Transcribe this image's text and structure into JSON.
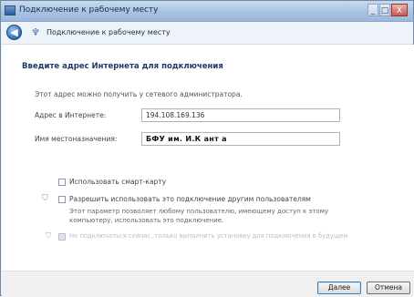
{
  "window": {
    "title": "Подключение к рабочему месту",
    "min_glyph": "_",
    "max_glyph": "□",
    "close_glyph": "X"
  },
  "nav": {
    "back_glyph": "◀",
    "title": "Подключение к рабочему месту"
  },
  "content": {
    "heading": "Введите адрес Интернета для подключения",
    "info": "Этот адрес можно получить у сетевого администратора.",
    "address_label": "Адрес в Интернете:",
    "address_value": "194.108.169.136",
    "name_label": "Имя местоназначения:",
    "name_value": "БФУ им. И.К ант а",
    "option_smartcard": "Использовать смарт-карту",
    "option_allow_others": "Разрешить использовать это подключение другим пользователям",
    "option_allow_others_desc": "Этот параметр позволяет любому пользователю, имеющему доступ к этому компьютеру, использовать это подключение.",
    "option_no_connect": "Не подключаться сейчас, только выполнить установку для подключения в будущем"
  },
  "buttons": {
    "next": "Далее",
    "cancel": "Отмена"
  },
  "colors": {
    "heading": "#1e3a66",
    "titlebar": "#a9c3e3",
    "content_bg": "#ffffff"
  }
}
